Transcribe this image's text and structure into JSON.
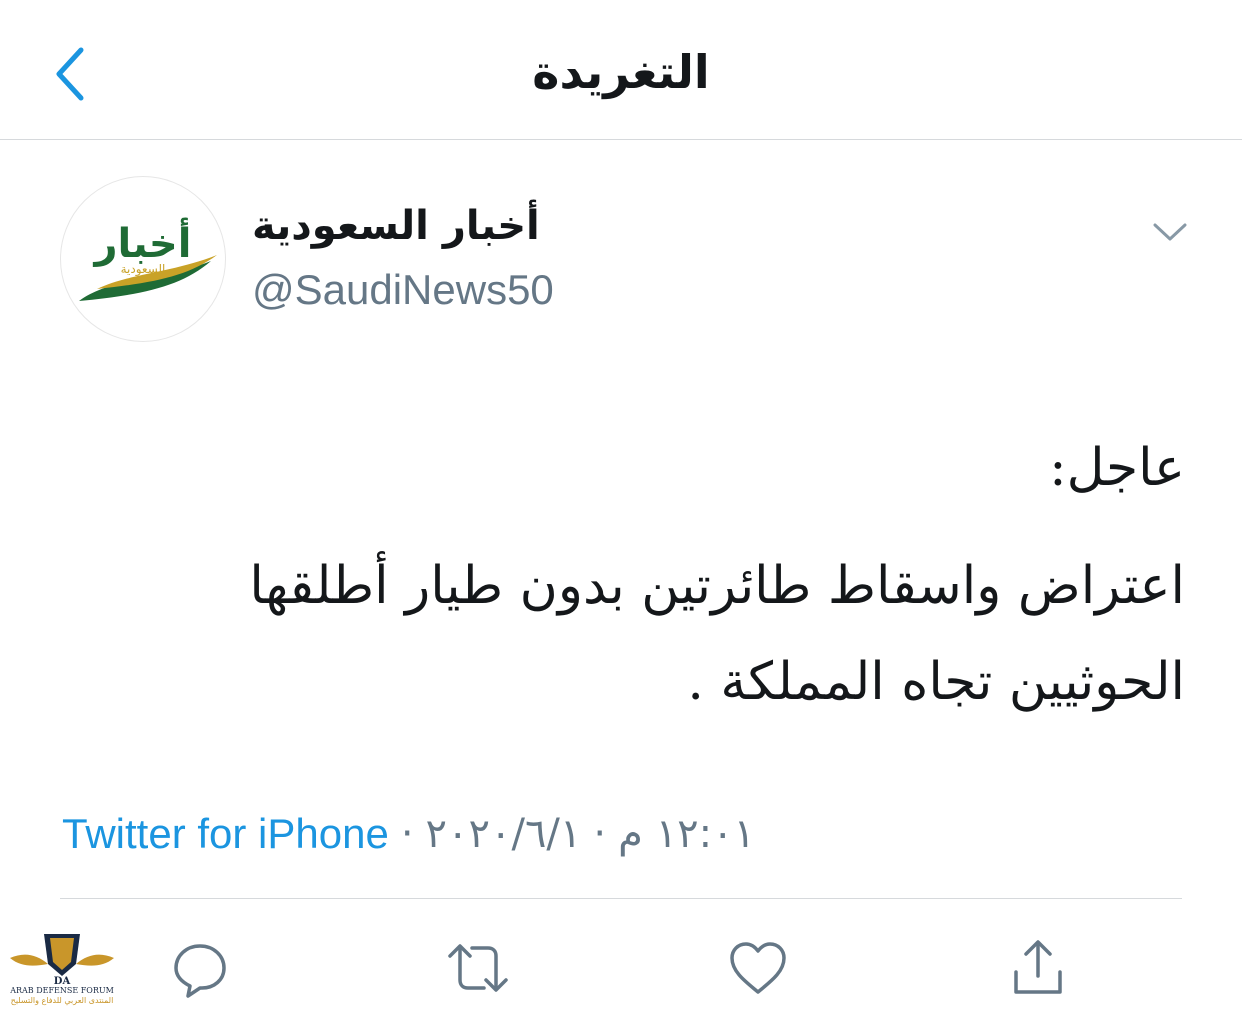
{
  "header": {
    "title": "التغريدة",
    "back_icon": "chevron-left-icon"
  },
  "author": {
    "display_name": "أخبار السعودية",
    "handle": "@SaudiNews50",
    "avatar_logo": "أخبار السعودية",
    "more_icon": "chevron-down-icon"
  },
  "tweet": {
    "line1": "عاجل:",
    "line2": "اعتراض واسقاط طائرتين بدون طيار أطلقها",
    "line3": "الحوثيين تجاه المملكة ."
  },
  "meta": {
    "time": "١٢:٠١ م",
    "date": "٢٠٢٠/٦/١",
    "separator": "·",
    "source": "Twitter for iPhone"
  },
  "actions": {
    "reply_icon": "reply-icon",
    "retweet_icon": "retweet-icon",
    "like_icon": "heart-icon",
    "share_icon": "share-icon"
  },
  "watermark": {
    "badge": "DA",
    "title": "ARAB DEFENSE FORUM",
    "subtitle": "المنتدى العربي للدفاع والتسليح"
  },
  "colors": {
    "accent": "#1b95e0",
    "text": "#14171a",
    "secondary": "#657786",
    "divider": "#d6d9dc",
    "logo_green": "#1f6b35",
    "logo_gold": "#c9a227"
  }
}
